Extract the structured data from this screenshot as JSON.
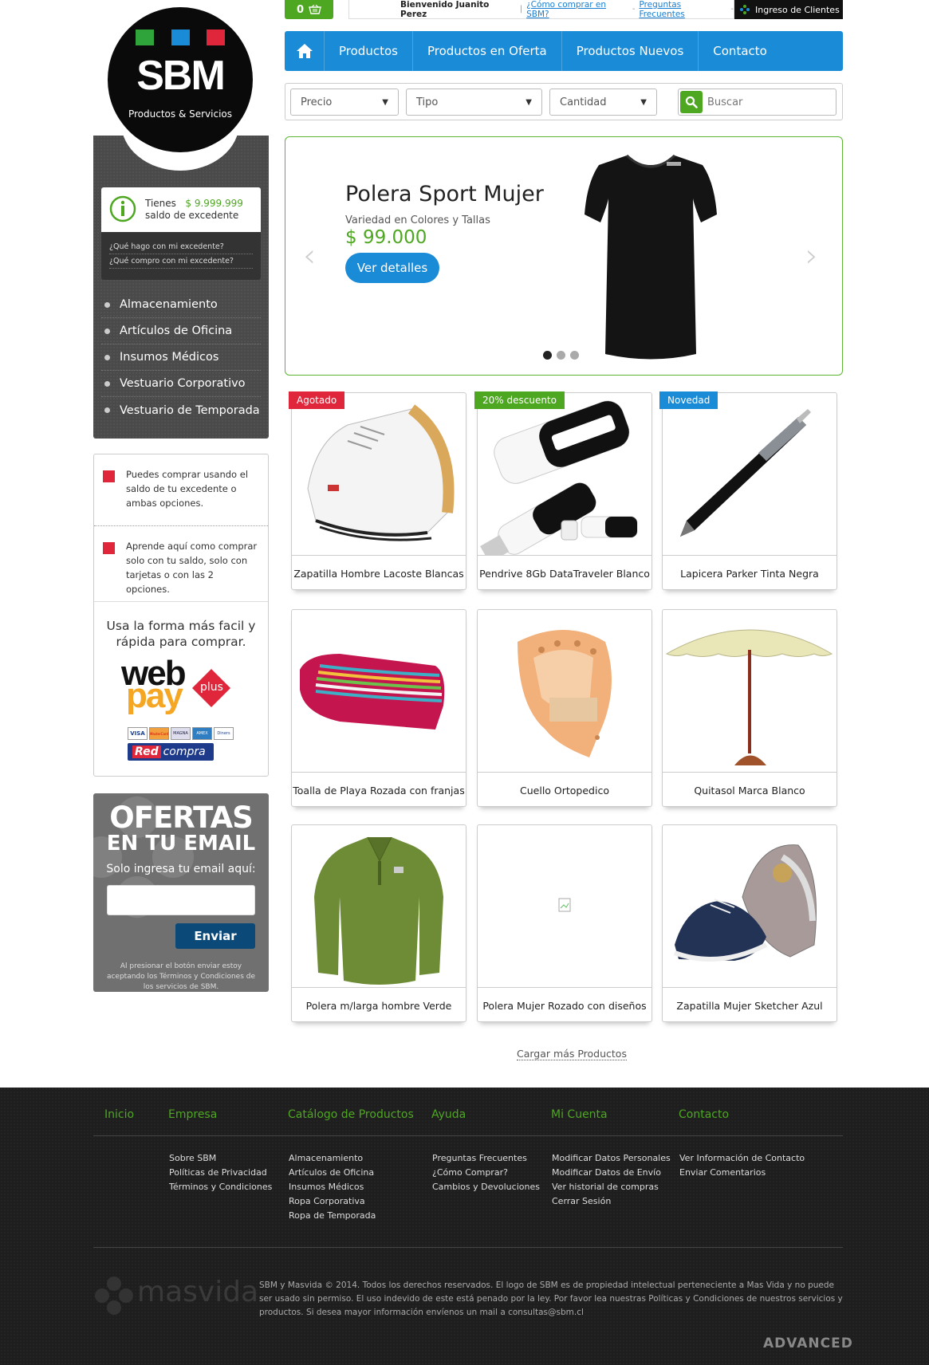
{
  "topbar": {
    "cart_count": "0",
    "welcome": "Bienvenido Juanito Perez",
    "link_how": "¿Cómo comprar en SBM?",
    "link_faq": "Preguntas Frecuentes",
    "sep1": "|",
    "sep2": "-",
    "sep3": "-",
    "client_login": "Ingreso de Clientes"
  },
  "logo": {
    "name": "SBM",
    "tagline": "Productos & Servicios",
    "square_colors": [
      "#2ea43a",
      "#1a8bd7",
      "#e0263a"
    ]
  },
  "nav": {
    "items": [
      "Productos",
      "Productos en Oferta",
      "Productos Nuevos",
      "Contacto"
    ]
  },
  "filters": {
    "price": "Precio",
    "type": "Tipo",
    "qty": "Cantidad",
    "search_placeholder": "Buscar",
    "arrow": "▼"
  },
  "hero": {
    "title": "Polera Sport Mujer",
    "subtitle": "Variedad en Colores y Tallas",
    "price": "$ 99.000",
    "button": "Ver detalles",
    "prev": "‹",
    "next": "›",
    "slide_count": 3,
    "active_slide": 1
  },
  "sidebar": {
    "balance_label": "Tienes",
    "balance_amount": "$ 9.999.999",
    "balance_desc": "saldo de excedente",
    "balance_links": [
      "¿Qué hago con mi excedente?",
      "¿Qué compro con mi excedente?"
    ],
    "categories": [
      "Almacenamiento",
      "Artículos de Oficina",
      "Insumos Médicos",
      "Vestuario Corporativo",
      "Vestuario de Temporada"
    ],
    "info": [
      "Puedes comprar usando el saldo de tu excedente o ambas opciones.",
      "Aprende aquí como comprar solo con tu saldo, solo con tarjetas o con las 2 opciones."
    ],
    "webpay_text": "Usa la forma más facil y rápida para comprar.",
    "webpay_brand": {
      "web": "web",
      "pay": "pay",
      "plus": "plus",
      "red": "Red",
      "compra": "compra",
      "cards": [
        "VISA",
        "MasterCard",
        "MAGNA",
        "AMEX",
        "Diners"
      ]
    }
  },
  "newsletter": {
    "title1": "OFERTAS",
    "title2": "EN TU EMAIL",
    "label": "Solo ingresa tu email aquí:",
    "button": "Enviar",
    "legal": "Al presionar el botón enviar estoy aceptando los Términos y Condiciones de los servicios de SBM."
  },
  "products": [
    {
      "name": "Zapatilla Hombre Lacoste Blancas",
      "badge": "Agotado",
      "badge_color": "#e0263a",
      "icon": "sneaker-white"
    },
    {
      "name": "Pendrive 8Gb DataTraveler Blanco",
      "badge": "20% descuento",
      "badge_color": "#4ea721",
      "icon": "usb-drive",
      "drive_label": "DataTraveler"
    },
    {
      "name": "Lapicera Parker Tinta Negra",
      "badge": "Novedad",
      "badge_color": "#1a8bd7",
      "icon": "pen"
    },
    {
      "name": "Toalla de Playa Rozada con franjas",
      "badge": "",
      "badge_color": "",
      "icon": "towel"
    },
    {
      "name": "Cuello Ortopedico",
      "badge": "",
      "badge_color": "",
      "icon": "neck-brace"
    },
    {
      "name": "Quitasol Marca Blanco",
      "badge": "",
      "badge_color": "",
      "icon": "umbrella"
    },
    {
      "name": "Polera m/larga hombre Verde",
      "badge": "",
      "badge_color": "",
      "icon": "polo-shirt"
    },
    {
      "name": "Polera Mujer Rozado con diseños",
      "badge": "",
      "badge_color": "",
      "icon": "broken-image"
    },
    {
      "name": "Zapatilla Mujer Sketcher Azul",
      "badge": "",
      "badge_color": "",
      "icon": "sneaker-blue"
    }
  ],
  "load_more": "Cargar más Productos",
  "footer": {
    "heads": [
      "Inicio",
      "Empresa",
      "Catálogo de Productos",
      "Ayuda",
      "Mi Cuenta",
      "Contacto"
    ],
    "empresa": [
      "Sobre SBM",
      "Políticas de Privacidad",
      "Términos y Condiciones"
    ],
    "catalogo": [
      "Almacenamiento",
      "Artículos de Oficina",
      "Insumos Médicos",
      "Ropa Corporativa",
      "Ropa de Temporada"
    ],
    "ayuda": [
      "Preguntas Frecuentes",
      "¿Cómo Comprar?",
      "Cambios y Devoluciones"
    ],
    "cuenta": [
      "Modificar Datos Personales",
      "Modificar Datos de Envío",
      "Ver historial de compras",
      "Cerrar Sesión"
    ],
    "contacto": [
      "Ver Información de Contacto",
      "Enviar Comentarios"
    ],
    "copyright": "SBM y Masvida © 2014. Todos los derechos reservados. El logo de SBM es de propiedad intelectual perteneciente a Mas Vida y no puede ser usado sin permiso. El uso indevido de este está penado por la ley. Por favor lea nuestras Políticas y Condiciones de nuestros servicios y productos. Si desea mayor información envíenos un mail a consultas@sbm.cl",
    "masvida": "masvida",
    "advanced": "ADVANCED"
  },
  "colors": {
    "green": "#4ea721",
    "blue": "#1a8bd7",
    "red": "#e0263a",
    "dark": "#1e1e1e"
  }
}
